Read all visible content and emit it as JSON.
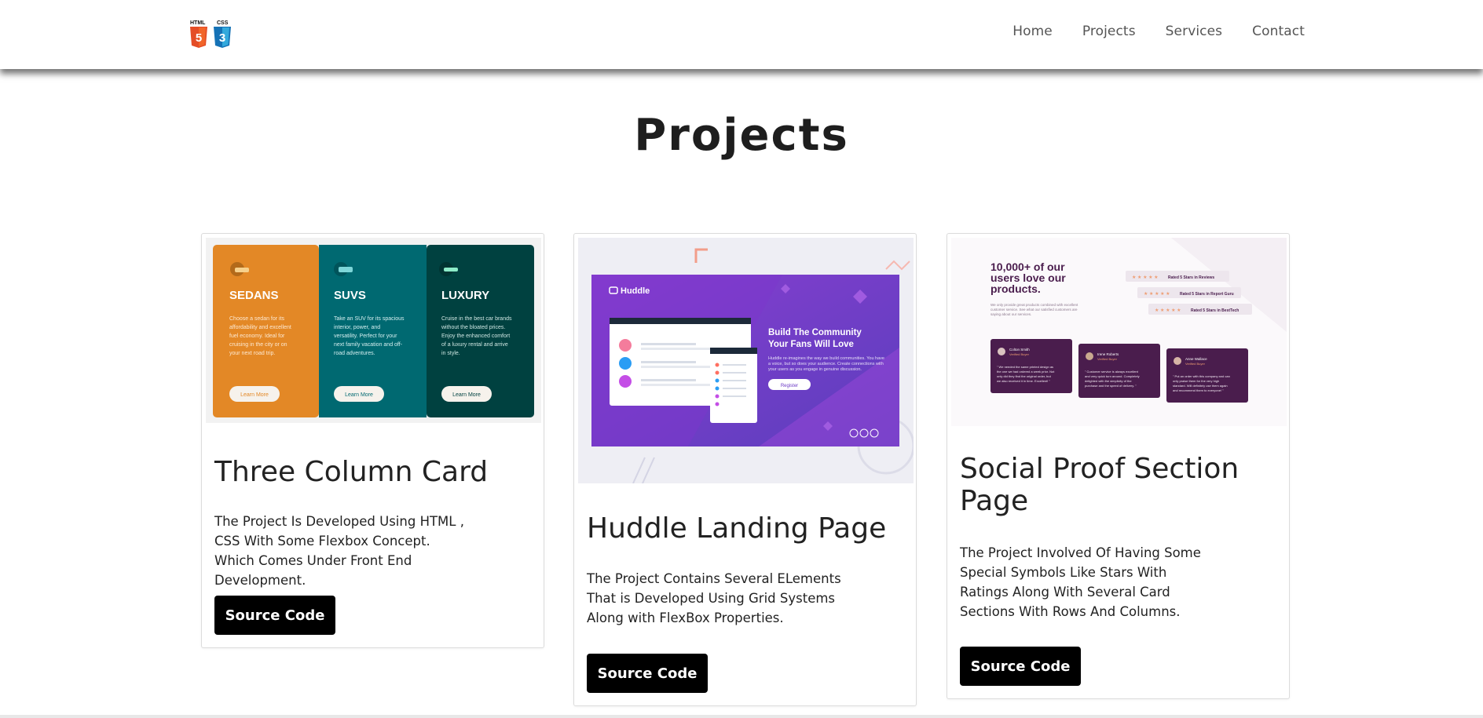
{
  "header": {
    "logo": {
      "html_label": "HTML",
      "css_label": "CSS",
      "html_number": "5",
      "css_number": "3"
    },
    "nav": [
      "Home",
      "Projects",
      "Services",
      "Contact"
    ]
  },
  "page": {
    "title": "Projects"
  },
  "colors": {
    "button_bg": "#000000",
    "button_text": "#ffffff",
    "sedans": "#e38826",
    "suvs": "#006971",
    "luxury": "#004140",
    "huddle_purple": "#6c3ac6",
    "social_proof_purple": "#4a1d4d"
  },
  "cards": [
    {
      "title": "Three Column Card",
      "description": "The Project Is Developed Using HTML , CSS With Some Flexbox Concept. Which Comes Under Front End Development.",
      "button": "Source Code",
      "preview": {
        "columns": [
          {
            "heading": "SEDANS",
            "text": [
              "Choose a sedan for its",
              "affordability and excellent",
              "fuel economy. Ideal for",
              "cruising in the city or on",
              "your next road trip."
            ],
            "button": "Learn More"
          },
          {
            "heading": "SUVS",
            "text": [
              "Take an SUV for its spacious",
              "interior, power, and",
              "versatility. Perfect for your",
              "next family vacation and off-",
              "road adventures."
            ],
            "button": "Learn More"
          },
          {
            "heading": "LUXURY",
            "text": [
              "Cruise in the best car brands",
              "without the bloated prices.",
              "Enjoy the enhanced comfort",
              "of a luxury rental and arrive",
              "in style."
            ],
            "button": "Learn More"
          }
        ]
      }
    },
    {
      "title": "Huddle Landing Page",
      "description": "The Project Contains Several ELements That is Developed Using Grid Systems Along with FlexBox Properties.",
      "button": "Source Code",
      "preview": {
        "brand": "Huddle",
        "heading": [
          "Build The Community",
          "Your Fans Will Love"
        ],
        "text": [
          "Huddle re-imagines the way we build communities. You have",
          "a voice, but so does your audience. Create connections with",
          "your users as you engage in genuine discussion."
        ],
        "button": "Register"
      }
    },
    {
      "title": "Social Proof Section Page",
      "description": "The Project Involved Of Having Some Special Symbols Like Stars With Ratings Along With Several Card Sections With Rows And Columns.",
      "button": "Source Code",
      "preview": {
        "heading": [
          "10,000+ of our",
          "users love our",
          "products."
        ],
        "text": [
          "We only provide great products combined with excellent",
          "customer service. See what our satisfied customers are",
          "saying about our services."
        ],
        "ratings": [
          "Rated 5 Stars in Reviews",
          "Rated 5 Stars in Report Guru",
          "Rated 5 Stars in BestTech"
        ],
        "stars": "★ ★ ★ ★ ★",
        "testimonials": [
          {
            "name": "Colton Smith",
            "status": "Verified Buyer",
            "quote": [
              "\" We needed the same printed design as",
              "the one we had ordered a week prior. Not",
              "only did they find the original order, but",
              "we also received it in time. Excellent! \""
            ]
          },
          {
            "name": "Irene Roberts",
            "status": "Verified Buyer",
            "quote": [
              "\" Customer service is always excellent",
              "and very quick turn around. Completely",
              "delighted with the simplicity of the",
              "purchase and the speed of delivery. \""
            ]
          },
          {
            "name": "Anne Wallace",
            "status": "Verified Buyer",
            "quote": [
              "\" Put an order with this company and can",
              "only praise them for the very high",
              "standard. Will definitely use them again",
              "and recommend them to everyone! \""
            ]
          }
        ]
      }
    }
  ]
}
